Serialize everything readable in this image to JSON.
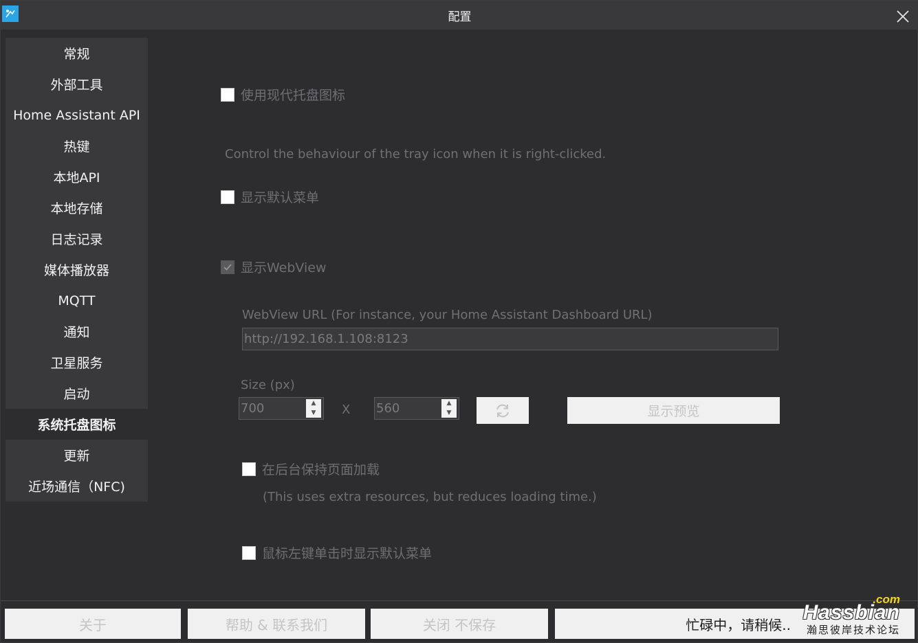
{
  "window": {
    "title": "配置"
  },
  "sidebar": {
    "items": [
      {
        "label": "常规"
      },
      {
        "label": "外部工具"
      },
      {
        "label": "Home Assistant API"
      },
      {
        "label": "热键"
      },
      {
        "label": "本地API"
      },
      {
        "label": "本地存储"
      },
      {
        "label": "日志记录"
      },
      {
        "label": "媒体播放器"
      },
      {
        "label": "MQTT"
      },
      {
        "label": "通知"
      },
      {
        "label": "卫星服务"
      },
      {
        "label": "启动"
      },
      {
        "label": "系统托盘图标",
        "active": true
      },
      {
        "label": "更新"
      },
      {
        "label": "近场通信（NFC)"
      }
    ]
  },
  "settings": {
    "modern_tray_icon": {
      "label": "使用现代托盘图标",
      "checked": false
    },
    "rightclick_desc": "Control the behaviour of the tray icon when it is right-clicked.",
    "show_default_menu": {
      "label": "显示默认菜单",
      "checked": false
    },
    "show_webview": {
      "label": "显示WebView",
      "checked": true
    },
    "webview_url_label": "WebView URL (For instance, your Home Assistant Dashboard URL)",
    "webview_url_value": "http://192.168.1.108:8123",
    "size_label": "Size (px)",
    "width_value": "700",
    "height_value": "560",
    "size_separator": "X",
    "preview_button": "显示预览",
    "keep_loaded": {
      "label": "在后台保持页面加载",
      "checked": false
    },
    "keep_loaded_note": "(This uses extra resources, but reduces loading time.)",
    "leftclick_menu": {
      "label": "鼠标左键单击时显示默认菜单",
      "checked": false
    }
  },
  "bottom": {
    "about": "关于",
    "help": "帮助 & 联系我们",
    "close_nosave": "关闭 不保存",
    "busy": "忙碌中，请稍候.."
  },
  "watermark": {
    "com": ".com",
    "brand": "Hassbian",
    "sub": "瀚思彼岸技术论坛"
  },
  "colors": {
    "accent": "#2aa6e6",
    "background": "#2d2d30",
    "sidebar": "#39393c"
  }
}
